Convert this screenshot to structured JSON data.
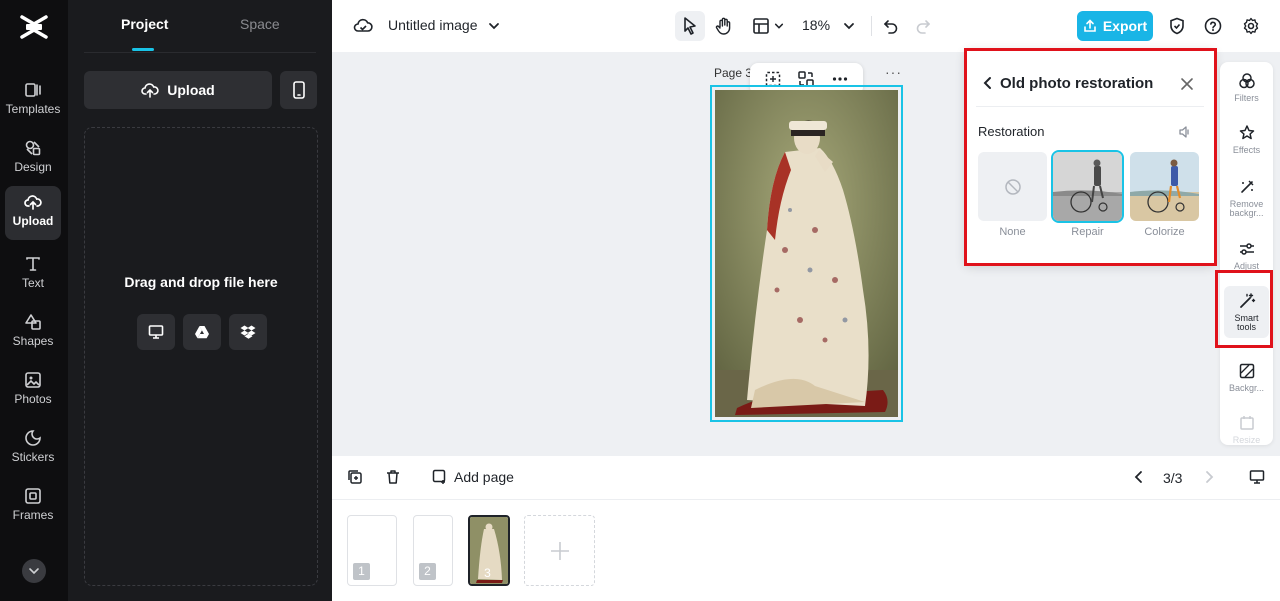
{
  "rail": {
    "items": [
      {
        "label": "Templates",
        "icon": "templates-icon"
      },
      {
        "label": "Design",
        "icon": "design-icon"
      },
      {
        "label": "Upload",
        "icon": "upload-icon"
      },
      {
        "label": "Text",
        "icon": "text-icon"
      },
      {
        "label": "Shapes",
        "icon": "shapes-icon"
      },
      {
        "label": "Photos",
        "icon": "photos-icon"
      },
      {
        "label": "Stickers",
        "icon": "stickers-icon"
      },
      {
        "label": "Frames",
        "icon": "frames-icon"
      }
    ],
    "active": "Upload"
  },
  "panel": {
    "tabs": [
      "Project",
      "Space"
    ],
    "upload_label": "Upload",
    "drop_text": "Drag and drop file here"
  },
  "topbar": {
    "title": "Untitled image",
    "zoom": "18%",
    "export_label": "Export"
  },
  "canvas": {
    "page_label": "Page 3"
  },
  "popup": {
    "title": "Old photo restoration",
    "section": "Restoration",
    "options": [
      "None",
      "Repair",
      "Colorize"
    ],
    "selected": "Repair"
  },
  "tools": {
    "items": [
      {
        "label": "Filters"
      },
      {
        "label": "Effects"
      },
      {
        "label": "Remove backgr..."
      },
      {
        "label": "Adjust"
      },
      {
        "label": "Smart tools"
      },
      {
        "label": "Backgr..."
      },
      {
        "label": "Resize"
      }
    ],
    "active": "Smart tools"
  },
  "bottom": {
    "add_page_label": "Add page",
    "page_count": "3/3",
    "thumbs": [
      "1",
      "2",
      "3"
    ]
  },
  "colors": {
    "accent": "#19c3e6",
    "export": "#19b5e6",
    "highlight": "#e0121b"
  }
}
